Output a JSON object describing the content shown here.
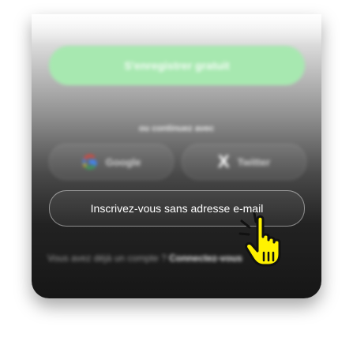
{
  "signup": {
    "primary_label": "S'enregistrer gratuit"
  },
  "divider": {
    "label": "ou continuez avec"
  },
  "social": {
    "google_label": "Google",
    "twitter_label": "Twitter"
  },
  "anonymous": {
    "label": "Inscrivez-vous sans adresse e-mail"
  },
  "footer": {
    "prompt": "Vous avez déjà un compte ? ",
    "link_label": "Connectez-vous"
  },
  "colors": {
    "primary_button": "#a7e8b0",
    "cursor_fill": "#fff200",
    "cursor_outline": "#111111"
  },
  "icons": {
    "google": "google-logo-icon",
    "twitter": "x-logo-icon",
    "cursor": "hand-pointer-cursor-icon"
  }
}
